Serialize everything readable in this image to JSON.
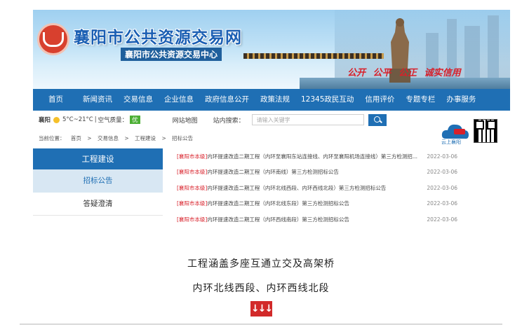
{
  "header": {
    "title": "襄阳市公共资源交易网",
    "subtitle": "襄阳市公共资源交易中心",
    "slogans": "公开 公平 公正 诚实信用"
  },
  "nav": {
    "items": [
      "首页",
      "新闻资讯",
      "交易信息",
      "企业信息",
      "政府信息公开",
      "政策法规",
      "12345政民互动",
      "信用评价",
      "专题专栏",
      "办事服务"
    ]
  },
  "infobar": {
    "city": "襄阳",
    "weather": "5°C~21°C",
    "air_label": "空气质量：",
    "air_value": "优",
    "sitemap": "网站地图",
    "search_label": "站内搜索：",
    "search_placeholder": "请输入关键字"
  },
  "breadcrumb": {
    "prefix": "当前位置：",
    "items": [
      "首页",
      ">",
      "交易信息",
      ">",
      "工程建设",
      ">",
      "招标公告"
    ]
  },
  "sidebar": {
    "heading": "工程建设",
    "active": "招标公告",
    "other": "答疑澄清"
  },
  "list": [
    {
      "tag": "[襄阳市本级]",
      "title": "内环提速改造二期工程（内环至襄阳东站连接线、内环至襄阳机场连接线）第三方检测招...",
      "date": "2022-03-06"
    },
    {
      "tag": "[襄阳市本级]",
      "title": "内环提速改造二期工程（内环南线）第三方检测招标公告",
      "date": "2022-03-06"
    },
    {
      "tag": "[襄阳市本级]",
      "title": "内环提速改造二期工程（内环北线西段、内环西线北段）第三方检测招标公告",
      "date": "2022-03-06"
    },
    {
      "tag": "[襄阳市本级]",
      "title": "内环提速改造二期工程（内环北线东段）第三方检测招标公告",
      "date": "2022-03-06"
    },
    {
      "tag": "[襄阳市本级]",
      "title": "内环提速改造二期工程（内环西线南段）第三方检测招标公告",
      "date": "2022-03-06"
    }
  ],
  "app_badge": "云上襄阳",
  "caption": {
    "line1": "工程涵盖多座互通立交及高架桥",
    "line2": "内环北线西段、内环西线北段",
    "arrows": "↓↓↓"
  },
  "colors": {
    "primary": "#1f6fb4",
    "accent": "#d8202a",
    "sidebar_active_bg": "#d8e7f3"
  }
}
